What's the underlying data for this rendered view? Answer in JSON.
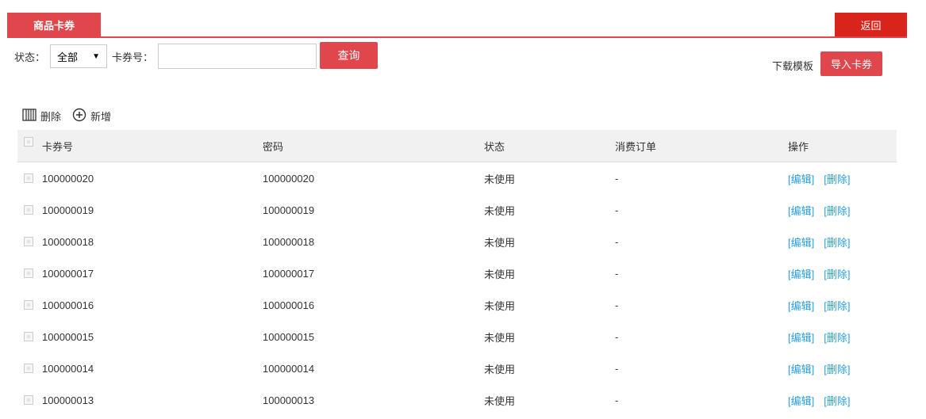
{
  "header": {
    "tab_label": "商品卡券",
    "back_label": "返回"
  },
  "filters": {
    "status_label": "状态：",
    "status_value": "全部",
    "code_label": "卡券号：",
    "code_value": "",
    "query_label": "查询"
  },
  "actions": {
    "download_template": "下载模板",
    "import_label": "导入卡券"
  },
  "toolbar": {
    "delete_label": "删除",
    "add_label": "新增"
  },
  "table": {
    "columns": {
      "code": "卡券号",
      "password": "密码",
      "status": "状态",
      "order": "消费订单",
      "ops": "操作"
    },
    "edit_label": "[编辑]",
    "delete_label": "[删除]",
    "rows": [
      {
        "code": "100000020",
        "password": "100000020",
        "status": "未使用",
        "order": "-"
      },
      {
        "code": "100000019",
        "password": "100000019",
        "status": "未使用",
        "order": "-"
      },
      {
        "code": "100000018",
        "password": "100000018",
        "status": "未使用",
        "order": "-"
      },
      {
        "code": "100000017",
        "password": "100000017",
        "status": "未使用",
        "order": "-"
      },
      {
        "code": "100000016",
        "password": "100000016",
        "status": "未使用",
        "order": "-"
      },
      {
        "code": "100000015",
        "password": "100000015",
        "status": "未使用",
        "order": "-"
      },
      {
        "code": "100000014",
        "password": "100000014",
        "status": "未使用",
        "order": "-"
      },
      {
        "code": "100000013",
        "password": "100000013",
        "status": "未使用",
        "order": "-"
      }
    ]
  },
  "colors": {
    "accent": "#e0474c",
    "back_button": "#d9241b",
    "link": "#2c9fe0"
  }
}
